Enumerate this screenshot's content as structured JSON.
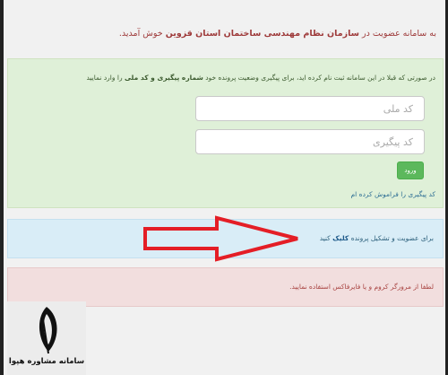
{
  "welcome": {
    "prefix": "به سامانه عضویت در",
    "org": "سازمان نظام مهندسی ساختمان استان قزوین",
    "suffix": "خوش آمدید."
  },
  "login_panel": {
    "intro_prefix": "در صورتی که قبلا در این سامانه ثبت نام کرده اید، برای پیگیری وضعیت پرونده خود",
    "intro_bold": "شماره پیگیری و کد ملی",
    "intro_suffix": "را وارد نمایید",
    "national_code_placeholder": "کد ملی",
    "tracking_code_placeholder": "کد پیگیری",
    "login_label": "ورود",
    "forgot_link": "کد پیگیری را فراموش کرده ام"
  },
  "register_panel": {
    "prefix": "برای عضویت و تشکیل پرونده",
    "link": "کلیک",
    "suffix": "کنید"
  },
  "browser_notice": "لطفا از مرورگر کروم و یا فایرفاکس استفاده نمایید.",
  "logo_text": "سامانه مشاوره هپوا",
  "colors": {
    "green_panel": "#dff0d8",
    "blue_panel": "#d9edf7",
    "red_panel": "#f2dede",
    "button": "#5cb85c",
    "arrow": "#e41e26"
  }
}
